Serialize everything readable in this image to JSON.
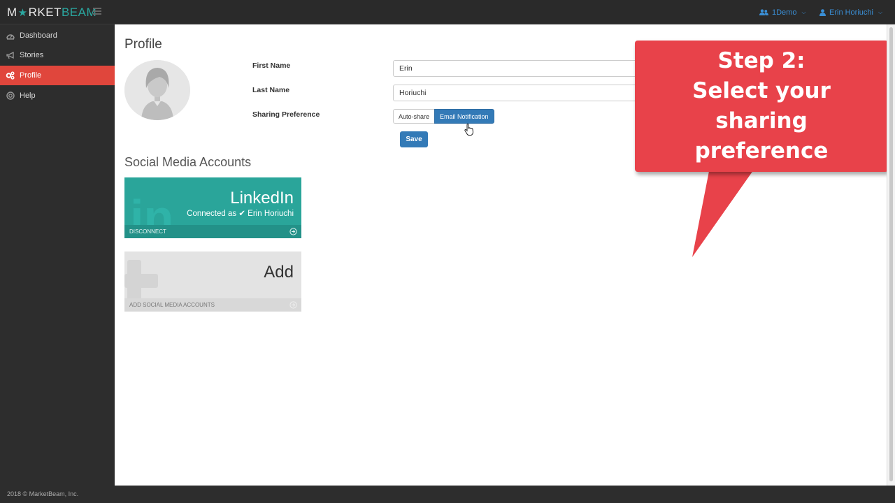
{
  "app": {
    "logo_prefix": "M",
    "logo_star": "★",
    "logo_mid": "RKET",
    "logo_suffix": "BEAM"
  },
  "topbar": {
    "org_label": "1Demo",
    "user_label": "Erin Horiuchi",
    "chevron": "⌄"
  },
  "sidebar": {
    "items": [
      {
        "label": "Dashboard",
        "icon": "dashboard-icon"
      },
      {
        "label": "Stories",
        "icon": "megaphone-icon"
      },
      {
        "label": "Profile",
        "icon": "gears-icon",
        "active": true
      },
      {
        "label": "Help",
        "icon": "lifebuoy-icon"
      }
    ]
  },
  "profile": {
    "title": "Profile",
    "first_name_label": "First Name",
    "first_name_value": "Erin",
    "last_name_label": "Last Name",
    "last_name_value": "Horiuchi",
    "sharing_label": "Sharing Preference",
    "sharing_options": [
      "Auto-share",
      "Email Notification"
    ],
    "sharing_selected": "Email Notification",
    "save_label": "Save"
  },
  "social": {
    "title": "Social Media Accounts",
    "linkedin": {
      "name": "LinkedIn",
      "connected_prefix": "Connected as",
      "connected_check": "✔",
      "connected_user": "Erin Horiuchi",
      "action": "DISCONNECT",
      "glyph": "in"
    },
    "add": {
      "name": "Add",
      "action": "ADD SOCIAL MEDIA ACCOUNTS"
    }
  },
  "callout": {
    "line1": "Step 2:",
    "line2": "Select your",
    "line3": "sharing",
    "line4": "preference"
  },
  "footer": {
    "text": "2018 © MarketBeam, Inc."
  },
  "colors": {
    "accent_red": "#e0463c",
    "brand_teal": "#2aa7a0",
    "primary_blue": "#337ab7",
    "callout_red": "#e8424a"
  }
}
